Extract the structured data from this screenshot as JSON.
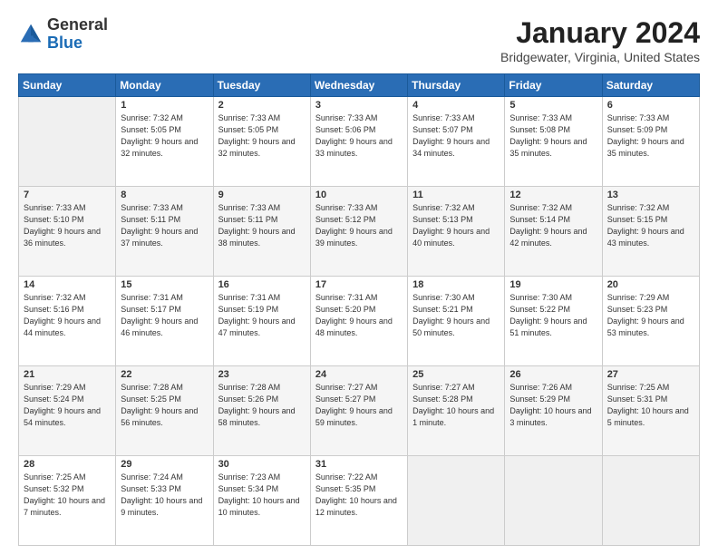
{
  "header": {
    "logo_general": "General",
    "logo_blue": "Blue",
    "month_title": "January 2024",
    "location": "Bridgewater, Virginia, United States"
  },
  "weekdays": [
    "Sunday",
    "Monday",
    "Tuesday",
    "Wednesday",
    "Thursday",
    "Friday",
    "Saturday"
  ],
  "weeks": [
    [
      {
        "day": "",
        "sunrise": "",
        "sunset": "",
        "daylight": ""
      },
      {
        "day": "1",
        "sunrise": "Sunrise: 7:32 AM",
        "sunset": "Sunset: 5:05 PM",
        "daylight": "Daylight: 9 hours and 32 minutes."
      },
      {
        "day": "2",
        "sunrise": "Sunrise: 7:33 AM",
        "sunset": "Sunset: 5:05 PM",
        "daylight": "Daylight: 9 hours and 32 minutes."
      },
      {
        "day": "3",
        "sunrise": "Sunrise: 7:33 AM",
        "sunset": "Sunset: 5:06 PM",
        "daylight": "Daylight: 9 hours and 33 minutes."
      },
      {
        "day": "4",
        "sunrise": "Sunrise: 7:33 AM",
        "sunset": "Sunset: 5:07 PM",
        "daylight": "Daylight: 9 hours and 34 minutes."
      },
      {
        "day": "5",
        "sunrise": "Sunrise: 7:33 AM",
        "sunset": "Sunset: 5:08 PM",
        "daylight": "Daylight: 9 hours and 35 minutes."
      },
      {
        "day": "6",
        "sunrise": "Sunrise: 7:33 AM",
        "sunset": "Sunset: 5:09 PM",
        "daylight": "Daylight: 9 hours and 35 minutes."
      }
    ],
    [
      {
        "day": "7",
        "sunrise": "Sunrise: 7:33 AM",
        "sunset": "Sunset: 5:10 PM",
        "daylight": "Daylight: 9 hours and 36 minutes."
      },
      {
        "day": "8",
        "sunrise": "Sunrise: 7:33 AM",
        "sunset": "Sunset: 5:11 PM",
        "daylight": "Daylight: 9 hours and 37 minutes."
      },
      {
        "day": "9",
        "sunrise": "Sunrise: 7:33 AM",
        "sunset": "Sunset: 5:11 PM",
        "daylight": "Daylight: 9 hours and 38 minutes."
      },
      {
        "day": "10",
        "sunrise": "Sunrise: 7:33 AM",
        "sunset": "Sunset: 5:12 PM",
        "daylight": "Daylight: 9 hours and 39 minutes."
      },
      {
        "day": "11",
        "sunrise": "Sunrise: 7:32 AM",
        "sunset": "Sunset: 5:13 PM",
        "daylight": "Daylight: 9 hours and 40 minutes."
      },
      {
        "day": "12",
        "sunrise": "Sunrise: 7:32 AM",
        "sunset": "Sunset: 5:14 PM",
        "daylight": "Daylight: 9 hours and 42 minutes."
      },
      {
        "day": "13",
        "sunrise": "Sunrise: 7:32 AM",
        "sunset": "Sunset: 5:15 PM",
        "daylight": "Daylight: 9 hours and 43 minutes."
      }
    ],
    [
      {
        "day": "14",
        "sunrise": "Sunrise: 7:32 AM",
        "sunset": "Sunset: 5:16 PM",
        "daylight": "Daylight: 9 hours and 44 minutes."
      },
      {
        "day": "15",
        "sunrise": "Sunrise: 7:31 AM",
        "sunset": "Sunset: 5:17 PM",
        "daylight": "Daylight: 9 hours and 46 minutes."
      },
      {
        "day": "16",
        "sunrise": "Sunrise: 7:31 AM",
        "sunset": "Sunset: 5:19 PM",
        "daylight": "Daylight: 9 hours and 47 minutes."
      },
      {
        "day": "17",
        "sunrise": "Sunrise: 7:31 AM",
        "sunset": "Sunset: 5:20 PM",
        "daylight": "Daylight: 9 hours and 48 minutes."
      },
      {
        "day": "18",
        "sunrise": "Sunrise: 7:30 AM",
        "sunset": "Sunset: 5:21 PM",
        "daylight": "Daylight: 9 hours and 50 minutes."
      },
      {
        "day": "19",
        "sunrise": "Sunrise: 7:30 AM",
        "sunset": "Sunset: 5:22 PM",
        "daylight": "Daylight: 9 hours and 51 minutes."
      },
      {
        "day": "20",
        "sunrise": "Sunrise: 7:29 AM",
        "sunset": "Sunset: 5:23 PM",
        "daylight": "Daylight: 9 hours and 53 minutes."
      }
    ],
    [
      {
        "day": "21",
        "sunrise": "Sunrise: 7:29 AM",
        "sunset": "Sunset: 5:24 PM",
        "daylight": "Daylight: 9 hours and 54 minutes."
      },
      {
        "day": "22",
        "sunrise": "Sunrise: 7:28 AM",
        "sunset": "Sunset: 5:25 PM",
        "daylight": "Daylight: 9 hours and 56 minutes."
      },
      {
        "day": "23",
        "sunrise": "Sunrise: 7:28 AM",
        "sunset": "Sunset: 5:26 PM",
        "daylight": "Daylight: 9 hours and 58 minutes."
      },
      {
        "day": "24",
        "sunrise": "Sunrise: 7:27 AM",
        "sunset": "Sunset: 5:27 PM",
        "daylight": "Daylight: 9 hours and 59 minutes."
      },
      {
        "day": "25",
        "sunrise": "Sunrise: 7:27 AM",
        "sunset": "Sunset: 5:28 PM",
        "daylight": "Daylight: 10 hours and 1 minute."
      },
      {
        "day": "26",
        "sunrise": "Sunrise: 7:26 AM",
        "sunset": "Sunset: 5:29 PM",
        "daylight": "Daylight: 10 hours and 3 minutes."
      },
      {
        "day": "27",
        "sunrise": "Sunrise: 7:25 AM",
        "sunset": "Sunset: 5:31 PM",
        "daylight": "Daylight: 10 hours and 5 minutes."
      }
    ],
    [
      {
        "day": "28",
        "sunrise": "Sunrise: 7:25 AM",
        "sunset": "Sunset: 5:32 PM",
        "daylight": "Daylight: 10 hours and 7 minutes."
      },
      {
        "day": "29",
        "sunrise": "Sunrise: 7:24 AM",
        "sunset": "Sunset: 5:33 PM",
        "daylight": "Daylight: 10 hours and 9 minutes."
      },
      {
        "day": "30",
        "sunrise": "Sunrise: 7:23 AM",
        "sunset": "Sunset: 5:34 PM",
        "daylight": "Daylight: 10 hours and 10 minutes."
      },
      {
        "day": "31",
        "sunrise": "Sunrise: 7:22 AM",
        "sunset": "Sunset: 5:35 PM",
        "daylight": "Daylight: 10 hours and 12 minutes."
      },
      {
        "day": "",
        "sunrise": "",
        "sunset": "",
        "daylight": ""
      },
      {
        "day": "",
        "sunrise": "",
        "sunset": "",
        "daylight": ""
      },
      {
        "day": "",
        "sunrise": "",
        "sunset": "",
        "daylight": ""
      }
    ]
  ]
}
